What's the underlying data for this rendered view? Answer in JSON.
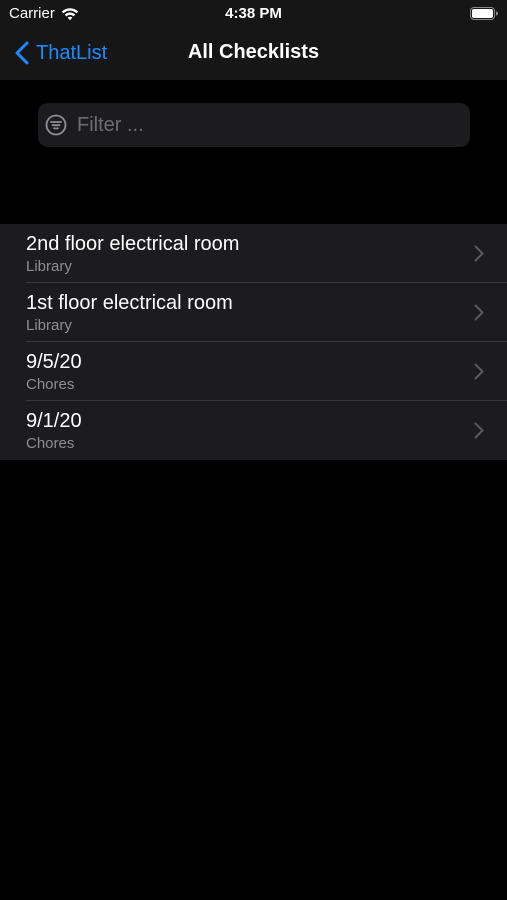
{
  "status_bar": {
    "carrier": "Carrier",
    "time": "4:38 PM"
  },
  "nav": {
    "back_label": "ThatList",
    "title": "All Checklists"
  },
  "filter": {
    "placeholder": "Filter ...",
    "value": ""
  },
  "checklists": [
    {
      "title": "2nd floor electrical room",
      "subtitle": "Library"
    },
    {
      "title": "1st floor electrical room",
      "subtitle": "Library"
    },
    {
      "title": "9/5/20",
      "subtitle": "Chores"
    },
    {
      "title": "9/1/20",
      "subtitle": "Chores"
    }
  ],
  "colors": {
    "accent": "#1a8cff",
    "background": "#000000",
    "cell_background": "#1c1c1e",
    "secondary_text": "#8e8e93"
  },
  "icons": {
    "wifi": "wifi-icon",
    "battery": "battery-icon",
    "back": "chevron-left-icon",
    "filter": "filter-icon",
    "disclosure": "chevron-right-icon"
  }
}
